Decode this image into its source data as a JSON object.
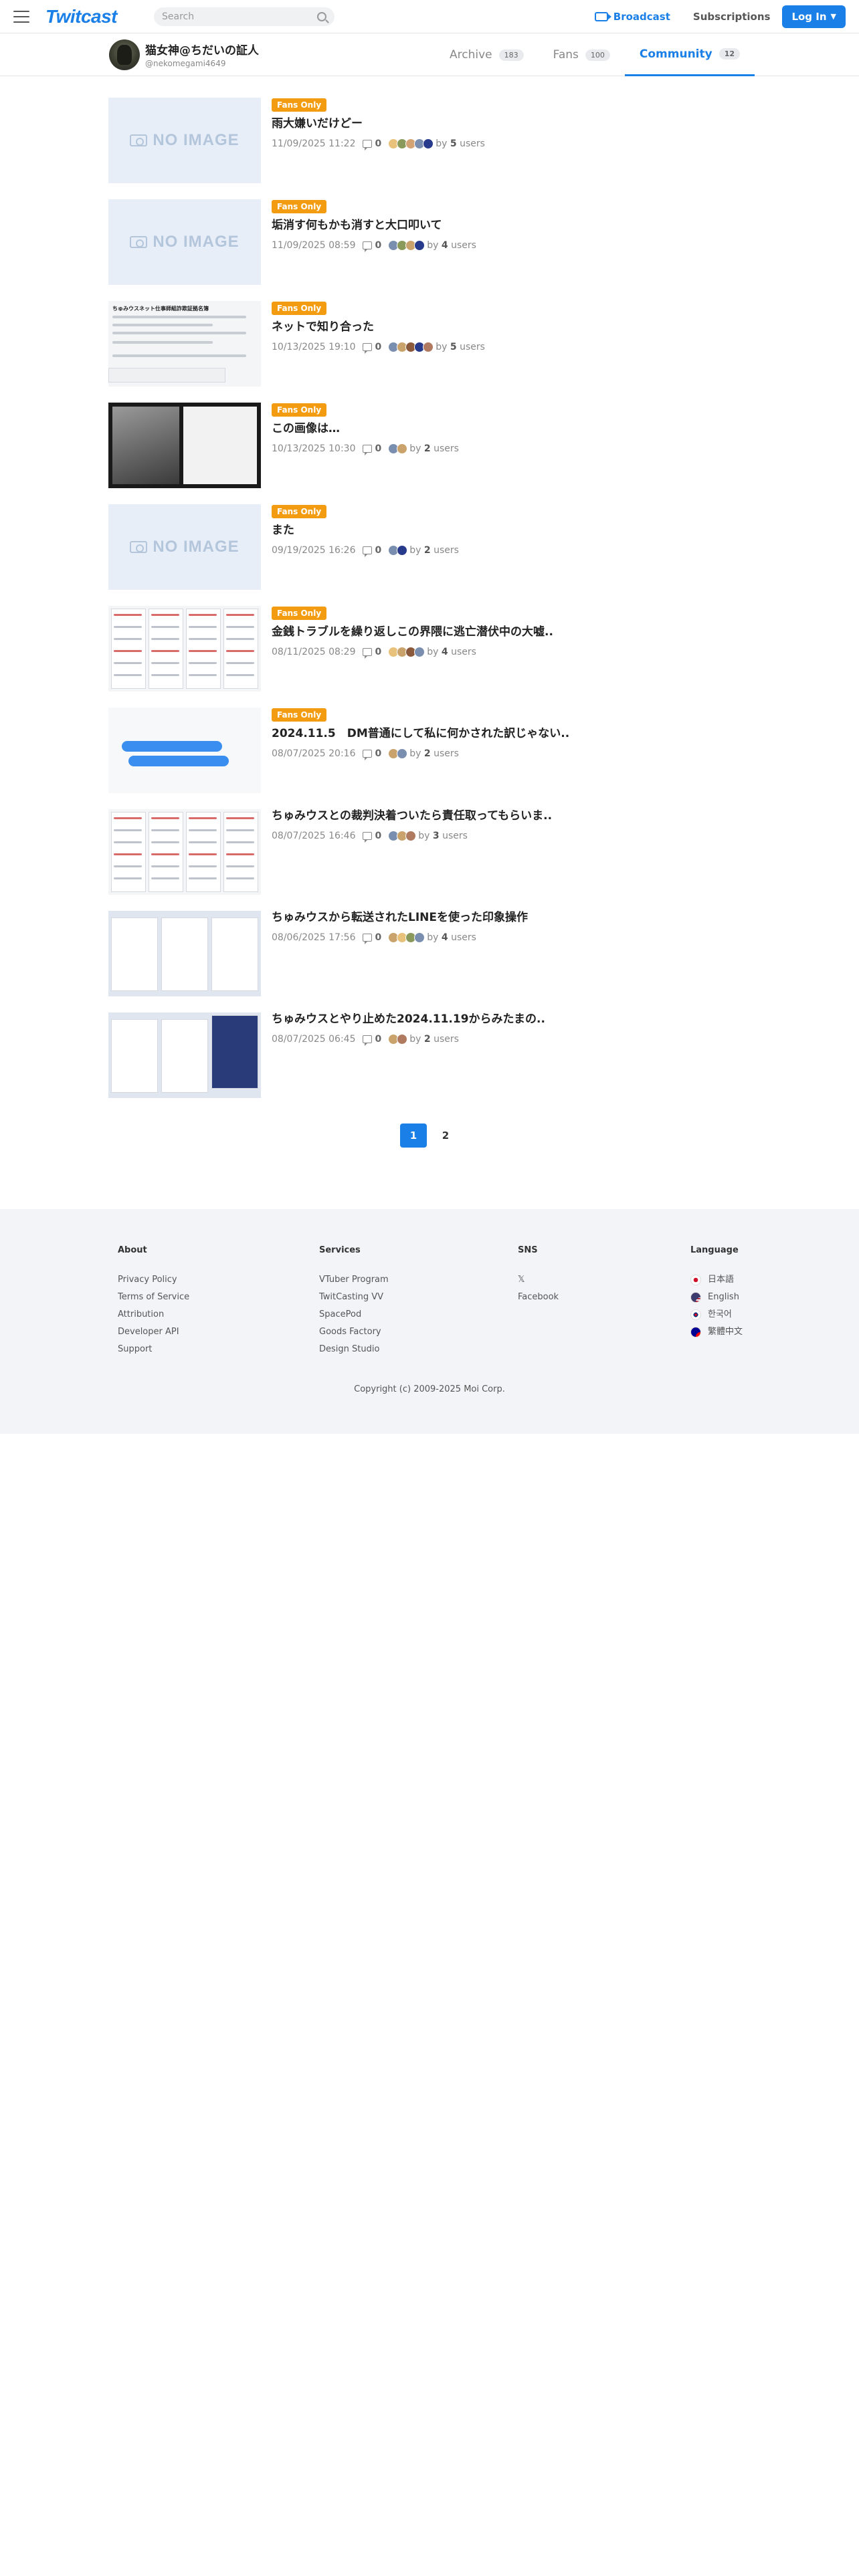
{
  "header": {
    "logo": "Twitcast",
    "search_placeholder": "Search",
    "broadcast_label": "Broadcast",
    "subscriptions_label": "Subscriptions",
    "login_label": "Log In"
  },
  "profile": {
    "name": "猫女神@ちだいの証人",
    "handle": "@nekomegami4649",
    "tabs": [
      {
        "label": "Archive",
        "count": "183"
      },
      {
        "label": "Fans",
        "count": "100"
      },
      {
        "label": "Community",
        "count": "12"
      }
    ]
  },
  "posts": [
    {
      "badge": "Fans Only",
      "title": "雨大嫌いだけどー",
      "date": "11/09/2025 11:22",
      "comments": "0",
      "by_prefix": "by",
      "users": "5",
      "users_suffix": "users",
      "thumb": "noimage",
      "avatars": [
        "#e8c27a",
        "#8a9a5b",
        "#d4a373",
        "#7a8fb0",
        "#283a8c"
      ]
    },
    {
      "badge": "Fans Only",
      "title": "垢消す何もかも消すと大口叩いて",
      "date": "11/09/2025 08:59",
      "comments": "0",
      "by_prefix": "by",
      "users": "4",
      "users_suffix": "users",
      "thumb": "noimage",
      "avatars": [
        "#7a8fb0",
        "#8a9a5b",
        "#c9a36b",
        "#283a8c"
      ]
    },
    {
      "badge": "Fans Only",
      "title": "ネットで知り合った",
      "date": "10/13/2025 19:10",
      "comments": "0",
      "by_prefix": "by",
      "users": "5",
      "users_suffix": "users",
      "thumb": "doc",
      "avatars": [
        "#7a8fb0",
        "#c9a36b",
        "#8b5a3c",
        "#283a8c",
        "#b07a60"
      ]
    },
    {
      "badge": "Fans Only",
      "title": "この画像は…",
      "date": "10/13/2025 10:30",
      "comments": "0",
      "by_prefix": "by",
      "users": "2",
      "users_suffix": "users",
      "thumb": "dark",
      "avatars": [
        "#7a8fb0",
        "#c9a36b"
      ]
    },
    {
      "badge": "Fans Only",
      "title": "また",
      "date": "09/19/2025 16:26",
      "comments": "0",
      "by_prefix": "by",
      "users": "2",
      "users_suffix": "users",
      "thumb": "noimage",
      "avatars": [
        "#7a8fb0",
        "#283a8c"
      ]
    },
    {
      "badge": "Fans Only",
      "title": "金銭トラブルを繰り返しこの界隈に逃亡潜伏中の大嘘..",
      "date": "08/11/2025 08:29",
      "comments": "0",
      "by_prefix": "by",
      "users": "4",
      "users_suffix": "users",
      "thumb": "doc2",
      "avatars": [
        "#e8c27a",
        "#c9a36b",
        "#8b5a3c",
        "#7a8fb0"
      ]
    },
    {
      "badge": "Fans Only",
      "title": "2024.11.5　DM普通にして私に何かされた訳じゃない..",
      "date": "08/07/2025 20:16",
      "comments": "0",
      "by_prefix": "by",
      "users": "2",
      "users_suffix": "users",
      "thumb": "chat",
      "avatars": [
        "#c9a36b",
        "#7a8fb0"
      ]
    },
    {
      "badge": "",
      "title": "ちゅみウスとの裁判決着ついたら責任取ってもらいま..",
      "date": "08/07/2025 16:46",
      "comments": "0",
      "by_prefix": "by",
      "users": "3",
      "users_suffix": "users",
      "thumb": "doc3",
      "avatars": [
        "#7a8fb0",
        "#c9a36b",
        "#b07a60"
      ]
    },
    {
      "badge": "",
      "title": "ちゅみウスから転送されたLINEを使った印象操作",
      "date": "08/06/2025 17:56",
      "comments": "0",
      "by_prefix": "by",
      "users": "4",
      "users_suffix": "users",
      "thumb": "collage",
      "avatars": [
        "#c9a36b",
        "#e8c27a",
        "#8a9a5b",
        "#7a8fb0"
      ]
    },
    {
      "badge": "",
      "title": "ちゅみウスとやり止めた2024.11.19からみたまの..",
      "date": "08/07/2025 06:45",
      "comments": "0",
      "by_prefix": "by",
      "users": "2",
      "users_suffix": "users",
      "thumb": "collage2",
      "avatars": [
        "#c9a36b",
        "#b07a60"
      ]
    }
  ],
  "thumb_text": {
    "noimage": "NO IMAGE",
    "doc_heading": "ちゅみウスネット仕事師組詐欺証拠名簿"
  },
  "pagination": [
    "1",
    "2"
  ],
  "footer": {
    "about": {
      "title": "About",
      "links": [
        "Privacy Policy",
        "Terms of Service",
        "Attribution",
        "Developer API",
        "Support"
      ]
    },
    "services": {
      "title": "Services",
      "links": [
        "VTuber Program",
        "TwitCasting VV",
        "SpacePod",
        "Goods Factory",
        "Design Studio"
      ]
    },
    "sns": {
      "title": "SNS",
      "links": [
        "𝕏",
        "Facebook"
      ]
    },
    "language": {
      "title": "Language",
      "links": [
        "日本語",
        "English",
        "한국어",
        "繁體中文"
      ]
    },
    "copyright": "Copyright (c) 2009-2025 Moi Corp."
  },
  "colors": {
    "accent": "#1a7fe6",
    "badge": "#f39c12"
  }
}
